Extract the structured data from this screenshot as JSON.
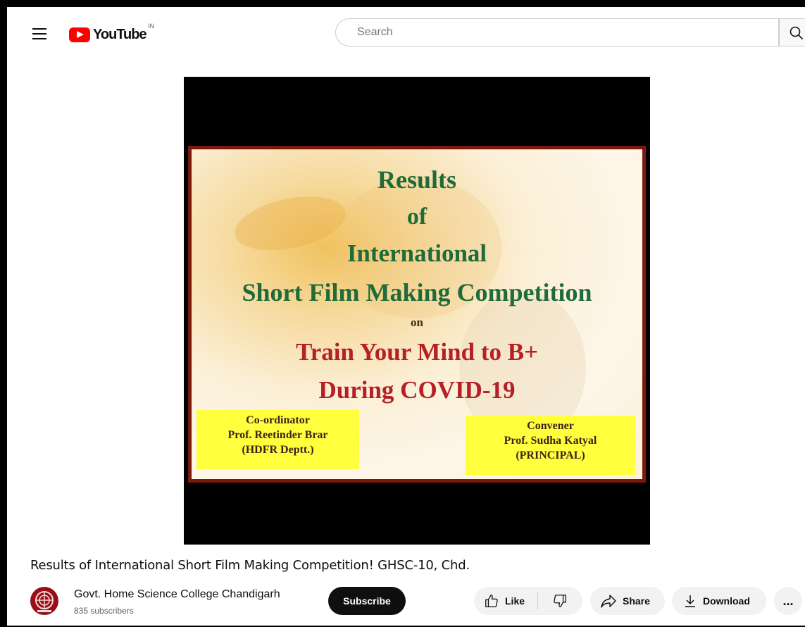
{
  "header": {
    "logo_text": "YouTube",
    "country_code": "IN",
    "search_placeholder": "Search"
  },
  "video": {
    "slide": {
      "line1": "Results",
      "line2": "of",
      "line3": "International",
      "line4": "Short Film Making Competition",
      "line5": "on",
      "line6": "Train  Your Mind to B+",
      "line7": "During COVID-19",
      "box_left": {
        "role": "Co-ordinator",
        "name": "Prof. Reetinder Brar",
        "dept": "(HDFR Deptt.)"
      },
      "box_right": {
        "role": "Convener",
        "name": "Prof. Sudha  Katyal",
        "dept": "(PRINCIPAL)"
      }
    },
    "title": "Results of International Short Film Making Competition! GHSC-10, Chd."
  },
  "channel": {
    "name": "Govt. Home Science College Chandigarh",
    "subscribers": "835 subscribers",
    "subscribe_label": "Subscribe"
  },
  "actions": {
    "like_label": "Like",
    "share_label": "Share",
    "download_label": "Download",
    "more_label": "..."
  },
  "colors": {
    "brand_red": "#ff0000",
    "slide_green": "#1f6b3a",
    "slide_red": "#b51f25",
    "yellow_box": "#ffff3e"
  }
}
